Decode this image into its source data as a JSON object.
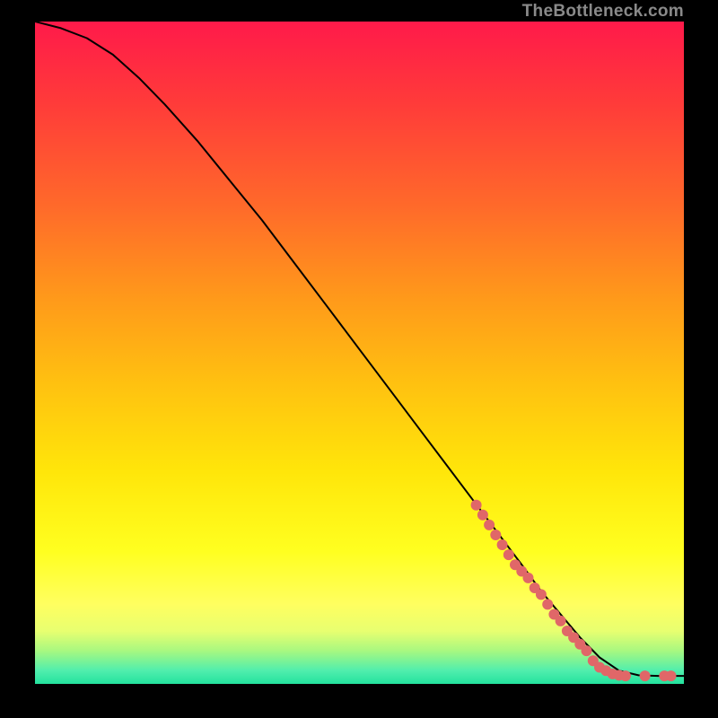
{
  "attribution": "TheBottleneck.com",
  "chart_data": {
    "type": "line",
    "title": "",
    "xlabel": "",
    "ylabel": "",
    "xlim": [
      0,
      100
    ],
    "ylim": [
      0,
      100
    ],
    "series": [
      {
        "name": "curve",
        "x": [
          0,
          4,
          8,
          12,
          16,
          20,
          25,
          30,
          35,
          40,
          45,
          50,
          55,
          60,
          65,
          70,
          75,
          78,
          81,
          84,
          87,
          90,
          93,
          96,
          100
        ],
        "y": [
          100,
          99,
          97.5,
          95,
          91.5,
          87.5,
          82,
          76,
          70,
          63.5,
          57,
          50.5,
          44,
          37.5,
          31,
          24.5,
          18,
          14,
          10.5,
          7,
          4,
          2,
          1.3,
          1.2,
          1.2
        ]
      }
    ],
    "markers": {
      "name": "segment-highlight",
      "color": "#e06768",
      "points": [
        {
          "x": 68,
          "y": 27
        },
        {
          "x": 69,
          "y": 25.5
        },
        {
          "x": 70,
          "y": 24
        },
        {
          "x": 71,
          "y": 22.5
        },
        {
          "x": 72,
          "y": 21
        },
        {
          "x": 73,
          "y": 19.5
        },
        {
          "x": 74,
          "y": 18
        },
        {
          "x": 75,
          "y": 17
        },
        {
          "x": 76,
          "y": 16
        },
        {
          "x": 77,
          "y": 14.5
        },
        {
          "x": 78,
          "y": 13.5
        },
        {
          "x": 79,
          "y": 12
        },
        {
          "x": 80,
          "y": 10.5
        },
        {
          "x": 81,
          "y": 9.5
        },
        {
          "x": 82,
          "y": 8
        },
        {
          "x": 83,
          "y": 7
        },
        {
          "x": 84,
          "y": 6
        },
        {
          "x": 85,
          "y": 5
        },
        {
          "x": 86,
          "y": 3.5
        },
        {
          "x": 87,
          "y": 2.5
        },
        {
          "x": 88,
          "y": 2
        },
        {
          "x": 89,
          "y": 1.5
        },
        {
          "x": 90,
          "y": 1.3
        },
        {
          "x": 91,
          "y": 1.2
        },
        {
          "x": 94,
          "y": 1.2
        },
        {
          "x": 97,
          "y": 1.2
        },
        {
          "x": 98,
          "y": 1.2
        }
      ]
    }
  },
  "gradient_stops": [
    {
      "pct": 0,
      "color": "#ff1a4a"
    },
    {
      "pct": 12,
      "color": "#ff3a3a"
    },
    {
      "pct": 28,
      "color": "#ff6a2a"
    },
    {
      "pct": 42,
      "color": "#ff9a1a"
    },
    {
      "pct": 55,
      "color": "#ffc210"
    },
    {
      "pct": 68,
      "color": "#ffe60a"
    },
    {
      "pct": 80,
      "color": "#ffff20"
    },
    {
      "pct": 88,
      "color": "#ffff60"
    },
    {
      "pct": 92,
      "color": "#e8ff70"
    },
    {
      "pct": 95,
      "color": "#a8f880"
    },
    {
      "pct": 98,
      "color": "#50eead"
    },
    {
      "pct": 100,
      "color": "#23e29e"
    }
  ]
}
